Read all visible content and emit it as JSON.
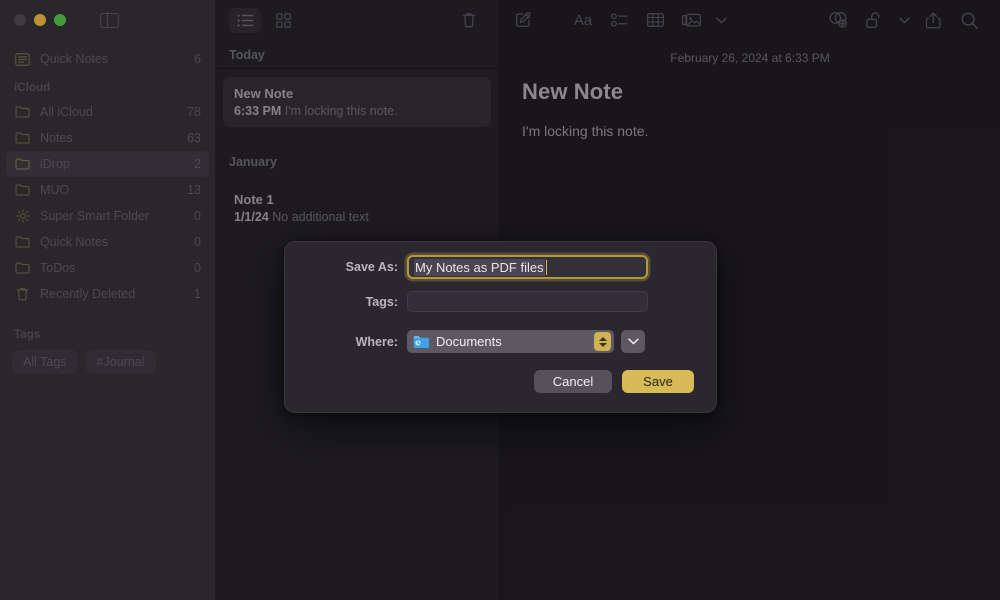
{
  "window": {
    "traffic_lights": [
      "close",
      "minimize",
      "maximize"
    ],
    "sidebar_toggle_icon": "sidebar-toggle-icon"
  },
  "sidebar": {
    "top_items": [
      {
        "icon": "quick-note-icon",
        "label": "Quick Notes",
        "count": "6"
      }
    ],
    "sections": [
      {
        "title": "iCloud",
        "items": [
          {
            "icon": "folder-icon",
            "label": "All iCloud",
            "count": "78",
            "selected": false
          },
          {
            "icon": "folder-icon",
            "label": "Notes",
            "count": "63",
            "selected": false
          },
          {
            "icon": "folder-icon",
            "label": "iDrop",
            "count": "2",
            "selected": true
          },
          {
            "icon": "folder-icon",
            "label": "MUO",
            "count": "13",
            "selected": false
          },
          {
            "icon": "gear-icon",
            "label": "Super Smart Folder",
            "count": "0",
            "selected": false
          },
          {
            "icon": "folder-icon",
            "label": "Quick Notes",
            "count": "0",
            "selected": false
          },
          {
            "icon": "folder-icon",
            "label": "ToDos",
            "count": "0",
            "selected": false
          },
          {
            "icon": "trash-icon",
            "label": "Recently Deleted",
            "count": "1",
            "selected": false
          }
        ]
      }
    ],
    "tags_title": "Tags",
    "tags": [
      {
        "label": "All Tags"
      },
      {
        "label": "#Journal"
      }
    ]
  },
  "notelist": {
    "toolbar": [
      {
        "icon": "list-view-icon",
        "active": true
      },
      {
        "icon": "gallery-view-icon",
        "active": false
      },
      {
        "icon": "trash-icon",
        "active": false
      }
    ],
    "groups": [
      {
        "header": "Today",
        "notes": [
          {
            "title": "New Note",
            "time": "6:33 PM",
            "snippet": "I'm locking this note.",
            "selected": true
          }
        ]
      },
      {
        "header": "January",
        "notes": [
          {
            "title": "Note 1",
            "time": "1/1/24",
            "snippet": "No additional text",
            "selected": false
          }
        ]
      }
    ]
  },
  "detail": {
    "toolbar": [
      {
        "icon": "compose-icon"
      },
      {
        "icon": "format-aa-icon"
      },
      {
        "icon": "checklist-icon"
      },
      {
        "icon": "table-icon"
      },
      {
        "icon": "media-icon"
      },
      {
        "icon": "chevron-down-icon"
      },
      {
        "icon": "collaborate-icon"
      },
      {
        "icon": "lock-open-icon"
      },
      {
        "icon": "chevron-down-icon"
      },
      {
        "icon": "share-icon"
      },
      {
        "icon": "search-icon"
      }
    ],
    "date": "February 26, 2024 at 6:33 PM",
    "title": "New Note",
    "body": "I'm locking this note."
  },
  "dialog": {
    "save_as_label": "Save As:",
    "save_as_value": "My Notes as PDF files",
    "tags_label": "Tags:",
    "tags_value": "",
    "tags_placeholder": "",
    "where_label": "Where:",
    "where_value": "Documents",
    "where_icon": "documents-folder-icon",
    "expand_icon": "chevron-down-icon",
    "cancel_label": "Cancel",
    "save_label": "Save"
  },
  "colors": {
    "accent_yellow": "#d6bb56",
    "field_focus_border": "#b2973f",
    "sidebar_bg": "#323036",
    "notelist_bg": "#242228",
    "detail_bg": "#1e1c21",
    "dialog_bg": "#2b272f",
    "traffic_minimize": "#e8b341",
    "traffic_maximize": "#52c04a",
    "folder_blue": "#3da2e8"
  }
}
